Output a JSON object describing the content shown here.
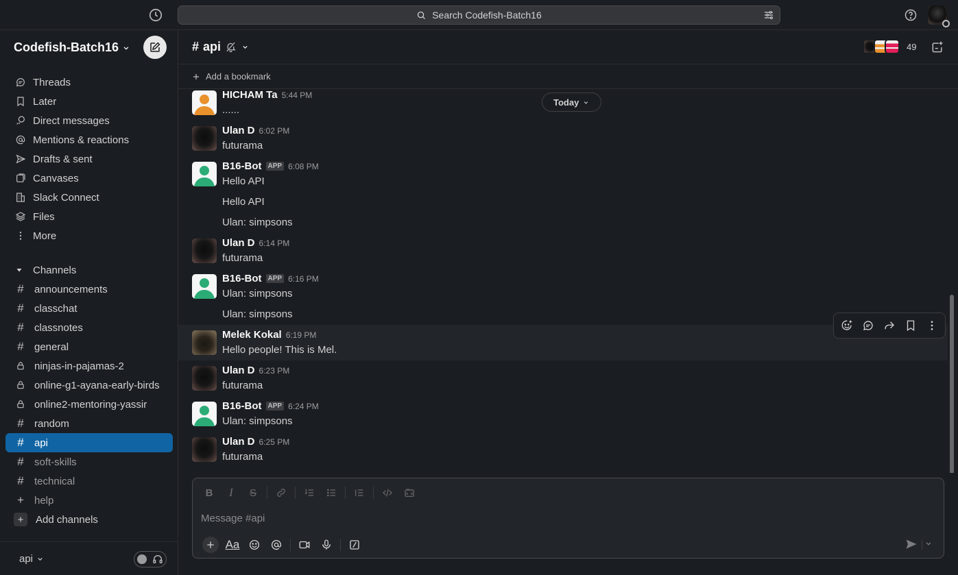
{
  "search": {
    "label": "Search Codefish-Batch16"
  },
  "workspace": {
    "name": "Codefish-Batch16"
  },
  "nav": [
    {
      "label": "Threads",
      "icon": "threads-icon"
    },
    {
      "label": "Later",
      "icon": "bookmark-icon"
    },
    {
      "label": "Direct messages",
      "icon": "dm-icon"
    },
    {
      "label": "Mentions & reactions",
      "icon": "at-icon"
    },
    {
      "label": "Drafts & sent",
      "icon": "send-icon"
    },
    {
      "label": "Canvases",
      "icon": "canvas-icon"
    },
    {
      "label": "Slack Connect",
      "icon": "building-icon"
    },
    {
      "label": "Files",
      "icon": "layers-icon"
    },
    {
      "label": "More",
      "icon": "more-vertical-icon"
    }
  ],
  "channels_section": {
    "label": "Channels"
  },
  "channels": [
    {
      "label": "announcements",
      "type": "public"
    },
    {
      "label": "classchat",
      "type": "public"
    },
    {
      "label": "classnotes",
      "type": "public"
    },
    {
      "label": "general",
      "type": "public"
    },
    {
      "label": "ninjas-in-pajamas-2",
      "type": "private"
    },
    {
      "label": "online-g1-ayana-early-birds",
      "type": "private"
    },
    {
      "label": "online2-mentoring-yassir",
      "type": "private"
    },
    {
      "label": "random",
      "type": "public"
    },
    {
      "label": "api",
      "type": "public",
      "active": true
    },
    {
      "label": "soft-skills",
      "type": "public",
      "muted": true
    },
    {
      "label": "technical",
      "type": "public",
      "muted": true
    },
    {
      "label": "help",
      "type": "add",
      "muted": true
    },
    {
      "label": "Add channels",
      "type": "add-box"
    }
  ],
  "sidebar_footer": {
    "label": "api"
  },
  "channel": {
    "name": "api",
    "member_count": "49",
    "add_bookmark": "Add a bookmark"
  },
  "today_label": "Today",
  "messages": [
    {
      "sender": "HICHAM Ta",
      "time": "5:44 PM",
      "avatar": "orange",
      "lines": [
        "......"
      ]
    },
    {
      "sender": "Ulan D",
      "time": "6:02 PM",
      "avatar": "dark",
      "lines": [
        "futurama"
      ]
    },
    {
      "sender": "B16-Bot",
      "app": "APP",
      "time": "6:08 PM",
      "avatar": "green",
      "lines": [
        "Hello API",
        "Hello API",
        "Ulan: simpsons"
      ]
    },
    {
      "sender": "Ulan D",
      "time": "6:14 PM",
      "avatar": "dark",
      "lines": [
        "futurama"
      ]
    },
    {
      "sender": "B16-Bot",
      "app": "APP",
      "time": "6:16 PM",
      "avatar": "green",
      "lines": [
        "Ulan: simpsons",
        "Ulan: simpsons"
      ]
    },
    {
      "sender": "Melek Kokal",
      "time": "6:19 PM",
      "avatar": "cat",
      "lines": [
        "Hello people! This is Mel."
      ]
    },
    {
      "sender": "Ulan D",
      "time": "6:23 PM",
      "avatar": "dark",
      "lines": [
        "futurama"
      ]
    },
    {
      "sender": "B16-Bot",
      "app": "APP",
      "time": "6:24 PM",
      "avatar": "green",
      "lines": [
        "Ulan: simpsons"
      ]
    },
    {
      "sender": "Ulan D",
      "time": "6:25 PM",
      "avatar": "dark",
      "lines": [
        "futurama"
      ]
    }
  ],
  "composer": {
    "placeholder": "Message #api"
  },
  "colors": {
    "active_channel": "#1164a3",
    "background": "#1a1d21",
    "bot_green": "#2bac76",
    "user_orange": "#e8912d"
  }
}
